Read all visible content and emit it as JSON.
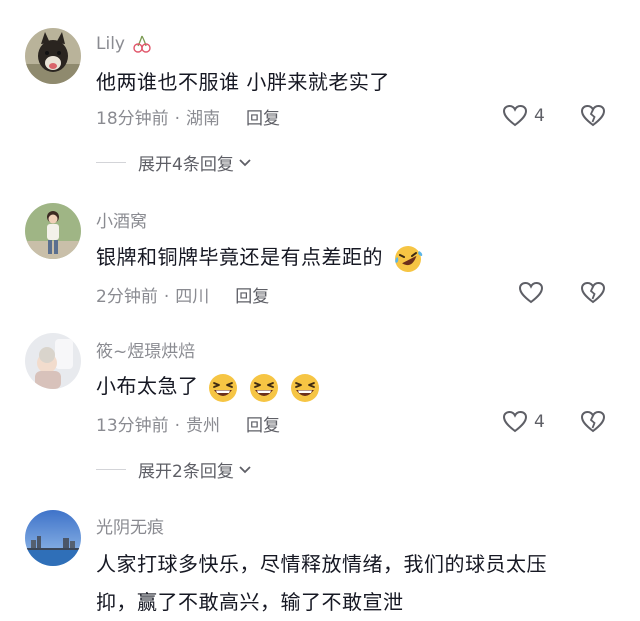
{
  "comments": [
    {
      "username": "Lily",
      "text": "他两谁也不服谁  小胖来就老实了",
      "time": "18分钟前",
      "location": "湖南",
      "reply_label": "回复",
      "likes": "4",
      "expand_label": "展开4条回复",
      "avatar_icon": "dog-photo-avatar"
    },
    {
      "username": "小酒窝",
      "text": "银牌和铜牌毕竟还是有点差距的",
      "time": "2分钟前",
      "location": "四川",
      "reply_label": "回复",
      "likes": "",
      "avatar_icon": "girl-photo-avatar"
    },
    {
      "username": "筱~煜璟烘焙",
      "text": "小布太急了",
      "time": "13分钟前",
      "location": "贵州",
      "reply_label": "回复",
      "likes": "4",
      "expand_label": "展开2条回复",
      "avatar_icon": "child-photo-avatar"
    },
    {
      "username": "光阴无痕",
      "text_line1": "人家打球多快乐，尽情释放情绪，我们的球员太压",
      "text_line2": "抑，赢了不敢高兴，输了不敢宣泄",
      "avatar_icon": "lake-city-photo-avatar"
    }
  ],
  "colors": {
    "text": "#161823",
    "muted": "#8a8b91",
    "divider": "#d3d4d8"
  }
}
